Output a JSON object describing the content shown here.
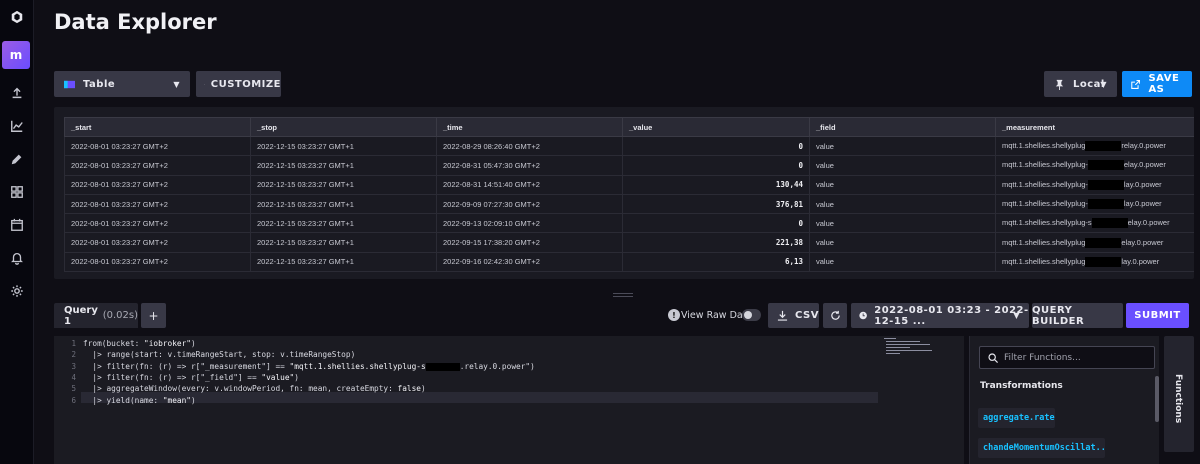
{
  "page": {
    "title": "Data Explorer"
  },
  "sidebar": {
    "org_initial": "m"
  },
  "toolbar": {
    "view_type": "Table",
    "customize_label": "CUSTOMIZE",
    "timezone": "Local",
    "save_as_label": "SAVE AS"
  },
  "table": {
    "columns": [
      "_start",
      "_stop",
      "_time",
      "_value",
      "_field",
      "_measurement"
    ],
    "rows": [
      [
        "2022-08-01 03:23:27 GMT+2",
        "2022-12-15 03:23:27 GMT+1",
        "2022-08-29 08:26:40 GMT+2",
        "0",
        "value",
        "mqtt.1.shellies.shellyplug",
        "relay.0.power"
      ],
      [
        "2022-08-01 03:23:27 GMT+2",
        "2022-12-15 03:23:27 GMT+1",
        "2022-08-31 05:47:30 GMT+2",
        "0",
        "value",
        "mqtt.1.shellies.shellyplug-",
        "elay.0.power"
      ],
      [
        "2022-08-01 03:23:27 GMT+2",
        "2022-12-15 03:23:27 GMT+1",
        "2022-08-31 14:51:40 GMT+2",
        "130,44",
        "value",
        "mqtt.1.shellies.shellyplug-",
        "lay.0.power"
      ],
      [
        "2022-08-01 03:23:27 GMT+2",
        "2022-12-15 03:23:27 GMT+1",
        "2022-09-09 07:27:30 GMT+2",
        "376,81",
        "value",
        "mqtt.1.shellies.shellyplug-",
        "lay.0.power"
      ],
      [
        "2022-08-01 03:23:27 GMT+2",
        "2022-12-15 03:23:27 GMT+1",
        "2022-09-13 02:09:10 GMT+2",
        "0",
        "value",
        "mqtt.1.shellies.shellyplug-s",
        "elay.0.power"
      ],
      [
        "2022-08-01 03:23:27 GMT+2",
        "2022-12-15 03:23:27 GMT+1",
        "2022-09-15 17:38:20 GMT+2",
        "221,38",
        "value",
        "mqtt.1.shellies.shellyplug",
        "elay.0.power"
      ],
      [
        "2022-08-01 03:23:27 GMT+2",
        "2022-12-15 03:23:27 GMT+1",
        "2022-09-16 02:42:30 GMT+2",
        "6,13",
        "value",
        "mqtt.1.shellies.shellyplug",
        "lay.0.power"
      ]
    ]
  },
  "query": {
    "tab_label": "Query 1",
    "tab_duration": "(0.02s)",
    "add_label": "+",
    "view_raw_label": "View Raw Data",
    "csv_label": "CSV",
    "time_range": "2022-08-01 03:23 - 2022-12-15 ...",
    "query_builder_label": "QUERY BUILDER",
    "submit_label": "SUBMIT"
  },
  "editor": {
    "lines": [
      {
        "num": "1",
        "a": "from(bucket: ",
        "b": "\"iobroker\"",
        "c": ")"
      },
      {
        "num": "2",
        "a": "  |> range(start: v.timeRangeStart, stop: v.timeRangeStop)",
        "b": "",
        "c": ""
      },
      {
        "num": "3",
        "a": "  |> filter(fn: (r) => r[\"_measurement\"] == ",
        "b": "\"mqtt.1.shellies.shellyplug-s",
        "c": ".relay.0.power\")"
      },
      {
        "num": "4",
        "a": "  |> filter(fn: (r) => r[\"_field\"] == ",
        "b": "\"value\"",
        "c": ")"
      },
      {
        "num": "5",
        "a": "  |> aggregateWindow(every: v.windowPeriod, fn: mean, createEmpty: ",
        "b": "false",
        "c": ")"
      },
      {
        "num": "6",
        "a": "  |> yield(name: ",
        "b": "\"mean\"",
        "c": ")"
      }
    ]
  },
  "functions": {
    "search_placeholder": "Filter Functions...",
    "heading": "Transformations",
    "items": [
      "aggregate.rate",
      "chandeMomentumOscillat..."
    ],
    "tab_label": "Functions"
  },
  "colors": {
    "accent_blue": "#0e8af6",
    "accent_purple": "#6a4fff",
    "fn_cyan": "#18c1ff"
  }
}
